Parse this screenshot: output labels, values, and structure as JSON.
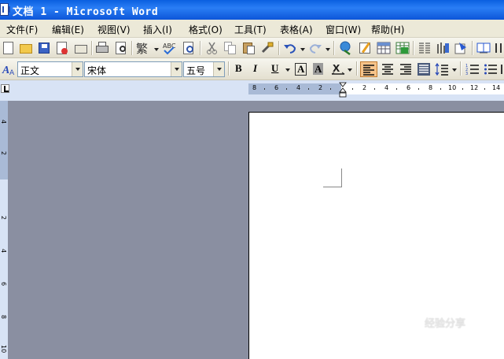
{
  "window": {
    "title": "文档 1 - Microsoft Word"
  },
  "menu": [
    {
      "label": "文件(F)"
    },
    {
      "label": "编辑(E)"
    },
    {
      "label": "视图(V)"
    },
    {
      "label": "插入(I)"
    },
    {
      "label": "格式(O)"
    },
    {
      "label": "工具(T)"
    },
    {
      "label": "表格(A)"
    },
    {
      "label": "窗口(W)"
    },
    {
      "label": "帮助(H)"
    }
  ],
  "toolbar1": {
    "icons": [
      "new-document-icon",
      "open-icon",
      "save-icon",
      "permission-icon",
      "email-icon",
      "print-icon",
      "print-preview-icon",
      "research-icon",
      "spelling-icon",
      "cut-icon",
      "copy-icon",
      "paste-icon",
      "format-painter-icon",
      "undo-icon",
      "redo-icon",
      "hyperlink-icon",
      "tables-borders-icon",
      "insert-table-icon",
      "insert-excel-icon",
      "columns-icon",
      "drawing-icon",
      "document-map-icon",
      "read-icon"
    ],
    "traditional_chinese_label": "繁"
  },
  "toolbar2": {
    "style": "正文",
    "font": "宋体",
    "size": "五号",
    "bold": "B",
    "italic": "I",
    "underline": "U",
    "char_border": "A",
    "char_shading": "A"
  },
  "ruler": {
    "h_numbers": [
      "8",
      "6",
      "4",
      "2",
      "2",
      "4",
      "6",
      "8",
      "10",
      "12",
      "14"
    ],
    "v_numbers": [
      "4",
      "2",
      "2",
      "4",
      "6",
      "8",
      "10"
    ]
  },
  "watermark": {
    "text": "经验分享"
  }
}
